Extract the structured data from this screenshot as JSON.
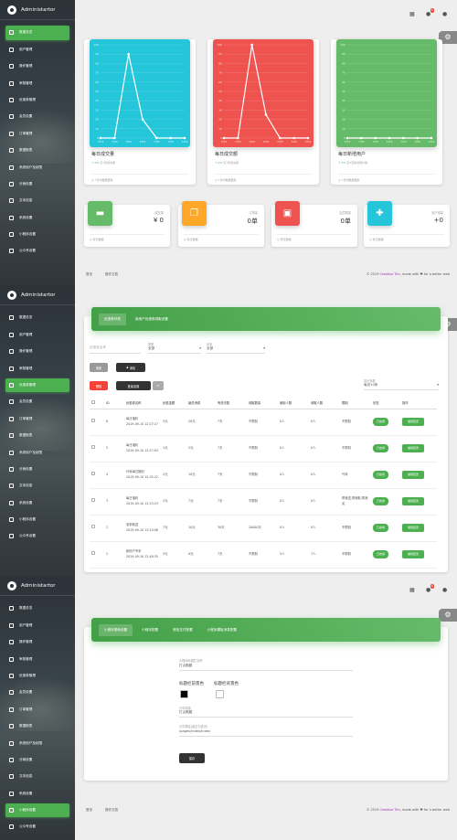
{
  "brand": "Administartor",
  "nav": [
    "数据总览",
    "用户管理",
    "操作管理",
    "审核管理",
    "优惠券管理",
    "会员设置",
    "订单管理",
    "数据报表",
    "系统用户及权限",
    "分销设置",
    "文本信息",
    "系统设置",
    "小程序设置",
    "公众号设置"
  ],
  "active": {
    "p1": 0,
    "p2": 4,
    "p3": 12
  },
  "topbar": {
    "badge": "6"
  },
  "colors": {
    "cyan": "#26c6da",
    "red": "#ef5350",
    "green": "#66bb6a",
    "orange": "#ffa726",
    "accent": "#4caf50"
  },
  "dashboard": {
    "charts": [
      {
        "title": "每日成交量",
        "sub_pct": "0%",
        "sub_text": "近7天成交量",
        "foot": "7日内数据更新"
      },
      {
        "title": "每日成交额",
        "sub_pct": "0%",
        "sub_text": "近7天成交额",
        "foot": "7日内数据更新"
      },
      {
        "title": "每日新增用户",
        "sub_pct": "0%",
        "sub_text": "近7天新增用户数",
        "foot": "7日内数据更新"
      }
    ],
    "stats": [
      {
        "label": "成交量",
        "value": "0",
        "foot": "暂无数据",
        "icon": "store-icon",
        "color": "#66bb6a"
      },
      {
        "label": "订单量",
        "value": "0单",
        "foot": "暂无数据",
        "icon": "copy-icon",
        "color": "#ffa726"
      },
      {
        "label": "会员数量",
        "value": "0单",
        "foot": "暂无数据",
        "icon": "contact-card-icon",
        "color": "#ef5350"
      },
      {
        "label": "用户增量",
        "value": "+0",
        "foot": "暂无数据",
        "icon": "group-add-icon",
        "color": "#26c6da"
      }
    ]
  },
  "chart_data": [
    {
      "type": "line",
      "title": "每日成交量",
      "x": [
        "7/02",
        "7/03",
        "7/02",
        "7/02",
        "7/03",
        "7/02",
        "7/02"
      ],
      "values": [
        0,
        0,
        90,
        20,
        0,
        0,
        0
      ],
      "ylim": [
        0,
        100
      ],
      "ylabels": [
        "100",
        "90",
        "80",
        "70",
        "60",
        "50",
        "40",
        "30",
        "20",
        "10",
        "0"
      ],
      "grid": true
    },
    {
      "type": "line",
      "title": "每日成交额",
      "x": [
        "7/02",
        "7/03",
        "7/02",
        "7/02",
        "7/03",
        "7/02",
        "7/02"
      ],
      "values": [
        0,
        0,
        100,
        25,
        0,
        0,
        0
      ],
      "ylim": [
        0,
        100
      ],
      "ylabels": [
        "100",
        "90",
        "80",
        "70",
        "60",
        "50",
        "40",
        "30",
        "20",
        "10",
        "0"
      ],
      "grid": true
    },
    {
      "type": "line",
      "title": "每日新增用户",
      "x": [
        "7/02",
        "7/03",
        "7/02",
        "7/02",
        "7/03",
        "7/02",
        "7/02"
      ],
      "values": [
        0,
        0,
        0,
        0,
        0,
        0,
        0
      ],
      "ylim": [
        0,
        100
      ],
      "ylabels": [
        "100",
        "90",
        "80",
        "70",
        "60",
        "50",
        "40",
        "30",
        "20",
        "10",
        "0"
      ],
      "grid": true
    }
  ],
  "footer": {
    "links": [
      "首页",
      "操作文档"
    ],
    "copy_prefix": "© 2019",
    "copy_brand": "Creative Tim",
    "copy_suffix": ", made with ♥ for a better web"
  },
  "coupons": {
    "tabs": [
      "优惠券列表",
      "新用户优惠券领取设置"
    ],
    "filter": {
      "search_placeholder": "优惠券名称",
      "type_label": "类型",
      "type_value": "全部",
      "status_label": "状态",
      "status_value": "全部"
    },
    "buttons": {
      "search": "搜索",
      "add": "添加",
      "delete": "删除",
      "batch": "批量设置"
    },
    "pagesize_label": "显示条数",
    "pagesize_value": "每页10条",
    "columns": [
      "ID",
      "优惠券名称",
      "优惠金额",
      "最低消费",
      "有效天数",
      "领取数量",
      "使用人数",
      "领取人数",
      "限制",
      "状态",
      "操作"
    ],
    "rows": [
      {
        "id": "6",
        "name": "每日福利\n2019-09-10 12:27:27",
        "amount": "5元",
        "min": "20元",
        "days": "7天",
        "qty": "不限制",
        "used": "0人",
        "got": "0人",
        "limit": "不限制",
        "status": "已启用",
        "op": "编辑配置"
      },
      {
        "id": "5",
        "name": "每日福利\n2019-09-10 12:27:03",
        "amount": "1元",
        "min": "2元",
        "days": "7天",
        "qty": "不限制",
        "used": "0人",
        "got": "0人",
        "limit": "不限制",
        "status": "已启用",
        "op": "编辑配置"
      },
      {
        "id": "4",
        "name": "代驾每日福利\n2019-09-10 12:35:22",
        "amount": "2元",
        "min": "10元",
        "days": "7天",
        "qty": "不限制",
        "used": "0人",
        "got": "0人",
        "limit": "代驾",
        "status": "已启用",
        "op": "编辑配置"
      },
      {
        "id": "3",
        "name": "每日福利\n2019-09-10 12:23:23",
        "amount": "2元",
        "min": "7元",
        "days": "7天",
        "qty": "不限制",
        "used": "0人",
        "got": "0人",
        "limit": "帮我送,帮我取,帮我买",
        "status": "已启用",
        "op": "编辑配置"
      },
      {
        "id": "2",
        "name": "老带新送\n2019-09-10 13:10:08",
        "amount": "7元",
        "min": "10元",
        "days": "30天",
        "qty": "20000次",
        "used": "0人",
        "got": "0人",
        "limit": "不限制",
        "status": "已启用",
        "op": "编辑配置"
      },
      {
        "id": "1",
        "name": "新用户专享\n2019-09-10 12:48:35",
        "amount": "3元",
        "min": "0元",
        "days": "7天",
        "qty": "不限制",
        "used": "5人",
        "got": "7人",
        "limit": "不限制",
        "status": "已启用",
        "op": "编辑配置"
      }
    ]
  },
  "mini": {
    "tabs": [
      "小程序基础设置",
      "小程序配置",
      "微信支付配置",
      "小程序模板消息配置"
    ],
    "name_label": "小程序标题栏名称",
    "name_value": "打点跑腿",
    "bg_label": "标题栏前景色",
    "bg_value": "#000000",
    "fg_label": "标题栏背景色",
    "fg_value": "#ffffff",
    "share_label": "分享标题",
    "share_value": "打点跑腿",
    "path_label": "分享路径(留空为首页)",
    "path_value": "/pages/index/index",
    "save": "保存"
  }
}
